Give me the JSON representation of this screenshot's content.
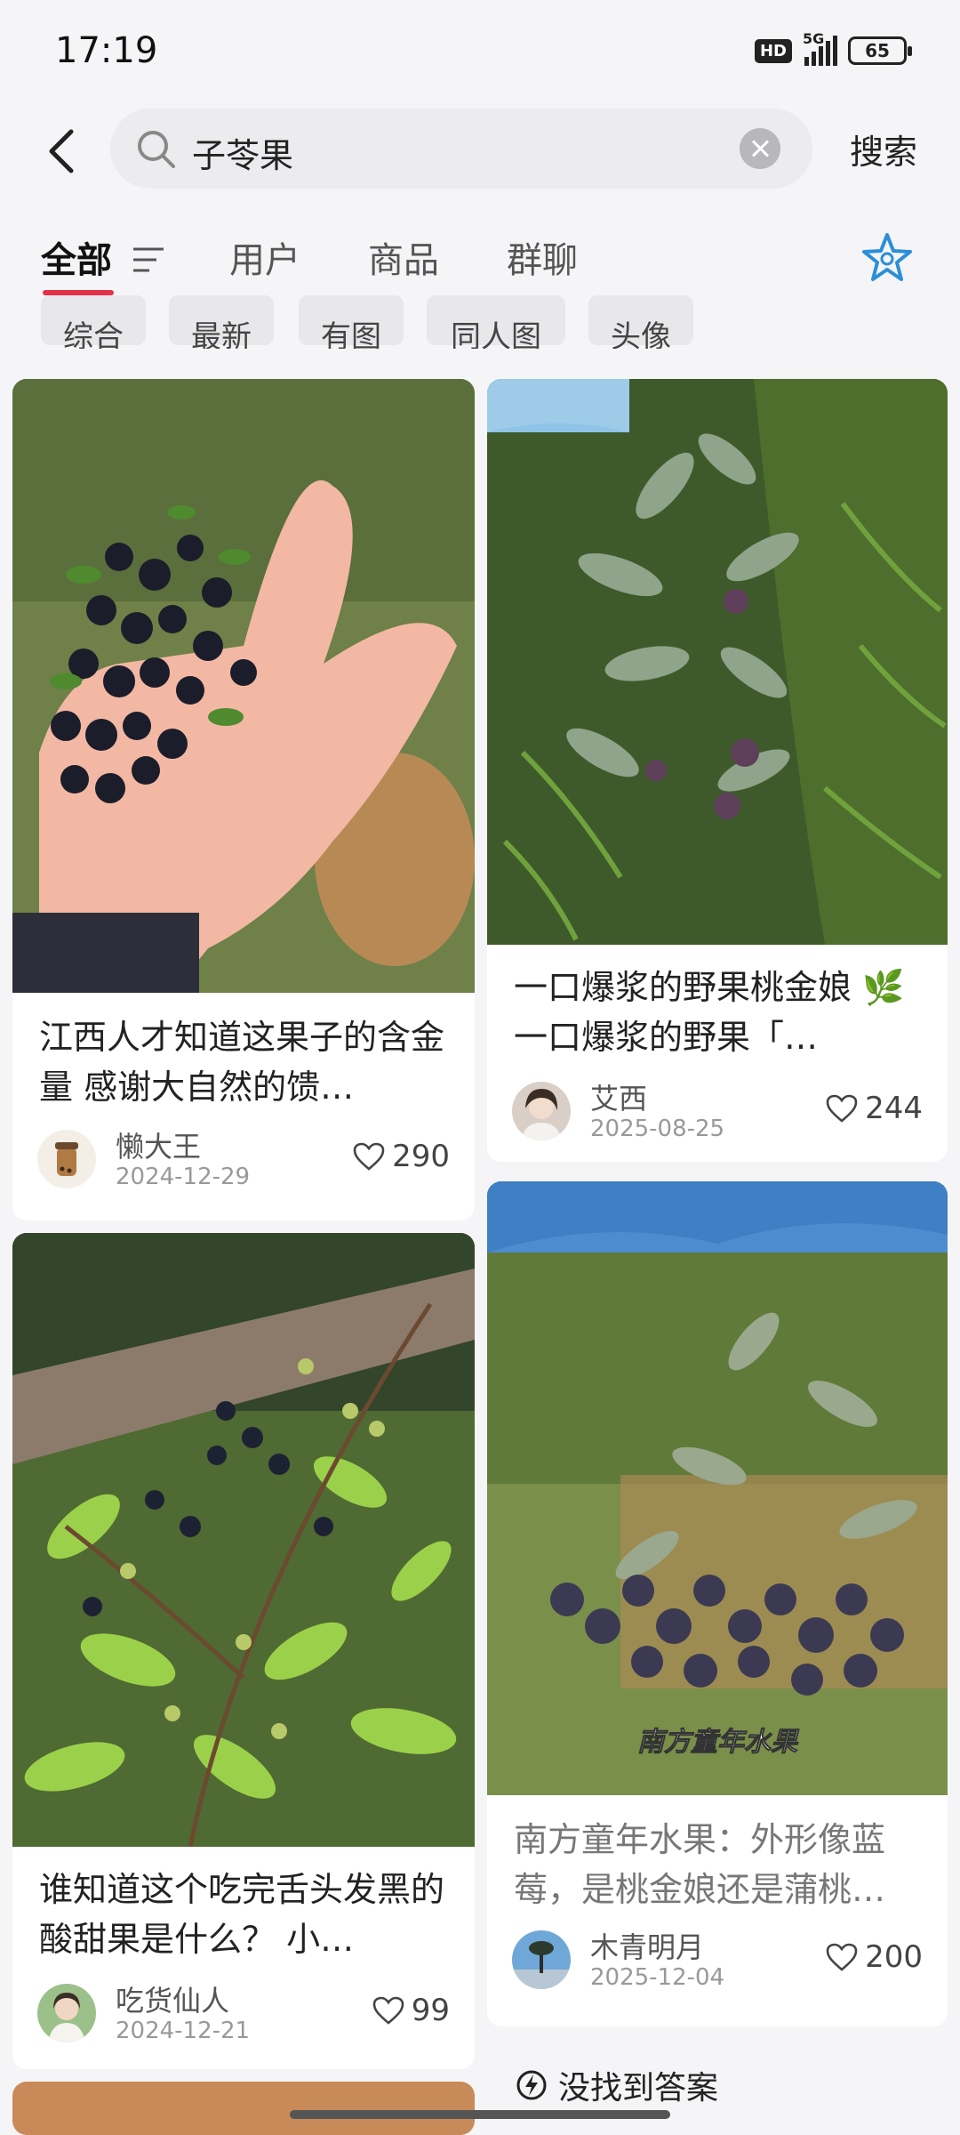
{
  "status": {
    "time": "17:19",
    "network_badge": "HD",
    "signal_label": "5G",
    "battery": "65"
  },
  "search": {
    "query": "子苓果",
    "button": "搜索"
  },
  "tabs": [
    {
      "label": "全部",
      "active": true
    },
    {
      "label": "用户"
    },
    {
      "label": "商品"
    },
    {
      "label": "群聊"
    }
  ],
  "chips": [
    "综合",
    "最新",
    "有图",
    "同人图",
    "头像"
  ],
  "posts": [
    {
      "title": "江西人才知道这果子的含金量 感谢大自然的馈…",
      "author": "懒大王",
      "date": "2024-12-29",
      "likes": "290"
    },
    {
      "title": "一口爆浆的野果桃金娘 🌿 一口爆浆的野果「…",
      "author": "艾西",
      "date": "2025-08-25",
      "likes": "244"
    },
    {
      "title": "谁知道这个吃完舌头发黑的酸甜果是什么？ 小…",
      "author": "吃货仙人",
      "date": "2024-12-21",
      "likes": "99"
    },
    {
      "title": "南方童年水果：外形像蓝莓，是桃金娘还是蒲桃…",
      "author": "木青明月",
      "date": "2025-12-04",
      "likes": "200",
      "image_caption": "南方童年水果"
    }
  ],
  "footer": {
    "tip": "没找到答案"
  },
  "colors": {
    "accent": "#e0334a",
    "star": "#2a8fd8"
  }
}
